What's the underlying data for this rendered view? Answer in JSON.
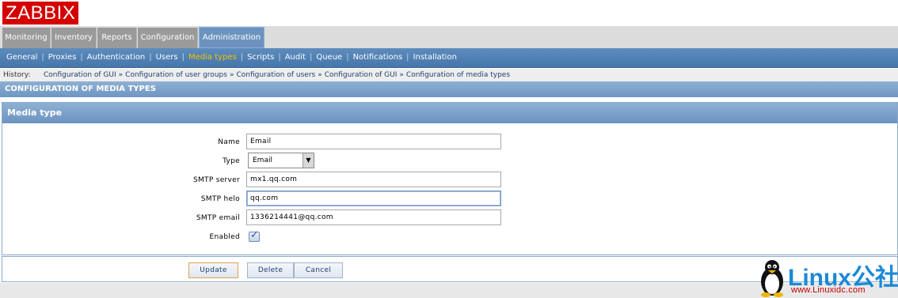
{
  "logo": {
    "text": "ZABBIX"
  },
  "top_menu": [
    {
      "label": "Monitoring",
      "active": false
    },
    {
      "label": "Inventory",
      "active": false
    },
    {
      "label": "Reports",
      "active": false
    },
    {
      "label": "Configuration",
      "active": false
    },
    {
      "label": "Administration",
      "active": true
    }
  ],
  "sub_menu": [
    {
      "label": "General",
      "active": false
    },
    {
      "label": "Proxies",
      "active": false
    },
    {
      "label": "Authentication",
      "active": false
    },
    {
      "label": "Users",
      "active": false
    },
    {
      "label": "Media types",
      "active": true
    },
    {
      "label": "Scripts",
      "active": false
    },
    {
      "label": "Audit",
      "active": false
    },
    {
      "label": "Queue",
      "active": false
    },
    {
      "label": "Notifications",
      "active": false
    },
    {
      "label": "Installation",
      "active": false
    }
  ],
  "history": {
    "label": "History:",
    "items": [
      "Configuration of GUI",
      "Configuration of user groups",
      "Configuration of users",
      "Configuration of GUI",
      "Configuration of media types"
    ],
    "separator": "»"
  },
  "page_title": "CONFIGURATION OF MEDIA TYPES",
  "form": {
    "title": "Media type",
    "name_label": "Name",
    "name_value": "Email",
    "type_label": "Type",
    "type_value": "Email",
    "smtp_server_label": "SMTP server",
    "smtp_server_value": "mx1.qq.com",
    "smtp_helo_label": "SMTP helo",
    "smtp_helo_value": "qq.com",
    "smtp_email_label": "SMTP email",
    "smtp_email_value": "1336214441@qq.com",
    "enabled_label": "Enabled",
    "enabled": true
  },
  "buttons": {
    "update": "Update",
    "delete": "Delete",
    "cancel": "Cancel"
  },
  "watermark": {
    "brand": "Linux公社",
    "url": "www.Linuxidc.com"
  },
  "colors": {
    "logo_bg": "#d40000",
    "submenu_active": "#f0c200",
    "header_blue": "#6c93bf"
  }
}
